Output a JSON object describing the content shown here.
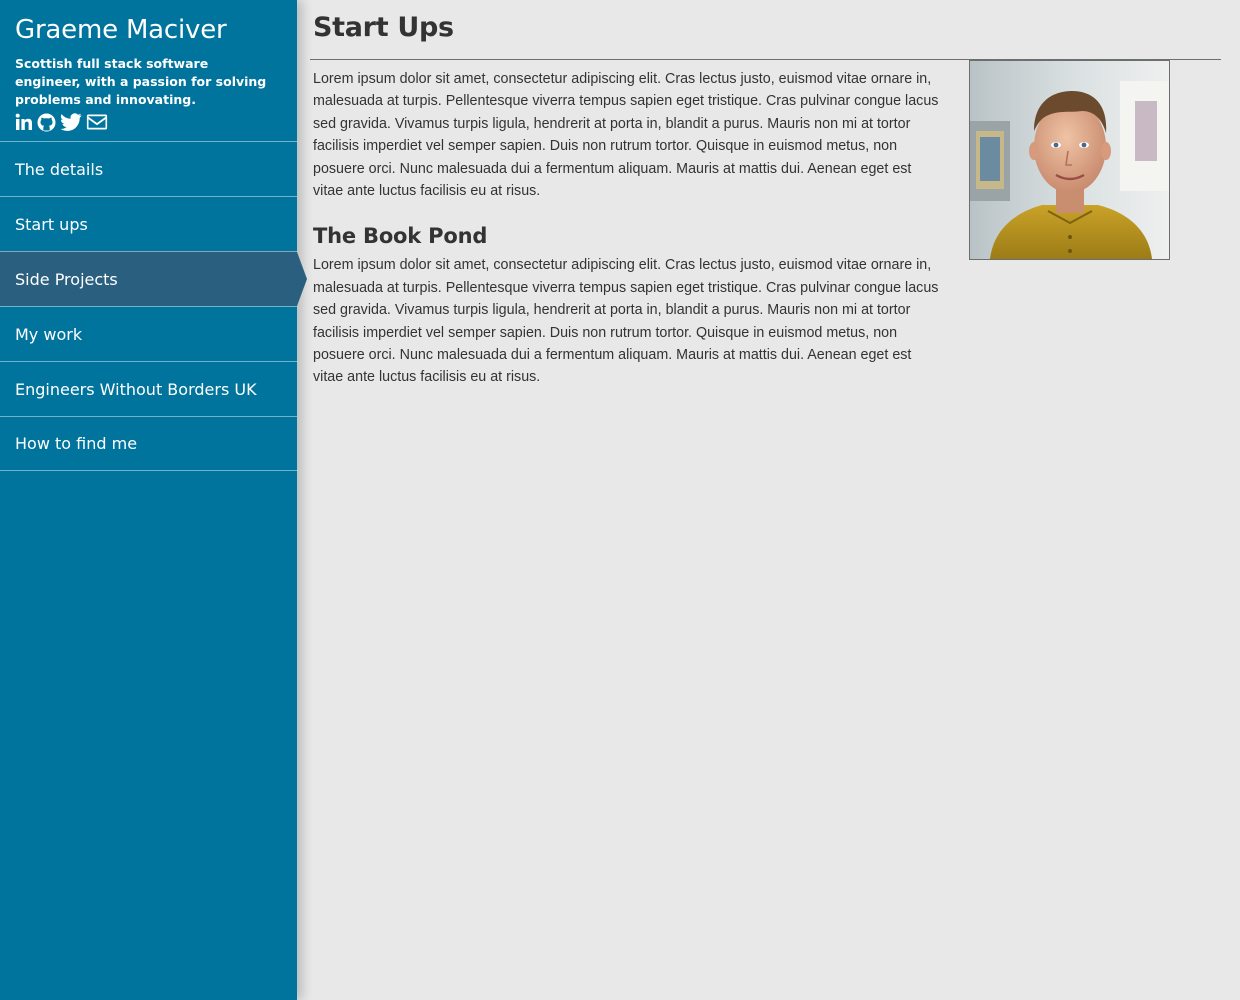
{
  "sidebar": {
    "name": "Graeme Maciver",
    "tagline": "Scottish full stack software engineer, with a passion for solving problems and innovating.",
    "social": [
      "linkedin-icon",
      "github-icon",
      "twitter-icon",
      "envelope-icon"
    ],
    "items": [
      {
        "label": "The details"
      },
      {
        "label": "Start ups"
      },
      {
        "label": "Side Projects",
        "active": true
      },
      {
        "label": "My work"
      },
      {
        "label": "Engineers Without Borders UK"
      },
      {
        "label": "How to find me"
      }
    ]
  },
  "main": {
    "title": "Start Ups",
    "intro": "Lorem ipsum dolor sit amet, consectetur adipiscing elit. Cras lectus justo, euismod vitae ornare in, malesuada at turpis. Pellentesque viverra tempus sapien eget tristique. Cras pulvinar congue lacus sed gravida. Vivamus turpis ligula, hendrerit at porta in, blandit a purus. Mauris non mi at tortor facilisis imperdiet vel semper sapien. Duis non rutrum tortor. Quisque in euismod metus, non posuere orci. Nunc malesuada dui a fermentum aliquam. Mauris at mattis dui. Aenean eget est vitae ante luctus facilisis eu at risus.",
    "sections": [
      {
        "title": "The Book Pond",
        "body": "Lorem ipsum dolor sit amet, consectetur adipiscing elit. Cras lectus justo, euismod vitae ornare in, malesuada at turpis. Pellentesque viverra tempus sapien eget tristique. Cras pulvinar congue lacus sed gravida. Vivamus turpis ligula, hendrerit at porta in, blandit a purus. Mauris non mi at tortor facilisis imperdiet vel semper sapien. Duis non rutrum tortor. Quisque in euismod metus, non posuere orci. Nunc malesuada dui a fermentum aliquam. Mauris at mattis dui. Aenean eget est vitae ante luctus facilisis eu at risus."
      }
    ]
  },
  "colors": {
    "sidebar": "#00749c",
    "sidebar_active": "#2a5f80",
    "background": "#e8e8e8",
    "text": "#333333"
  }
}
